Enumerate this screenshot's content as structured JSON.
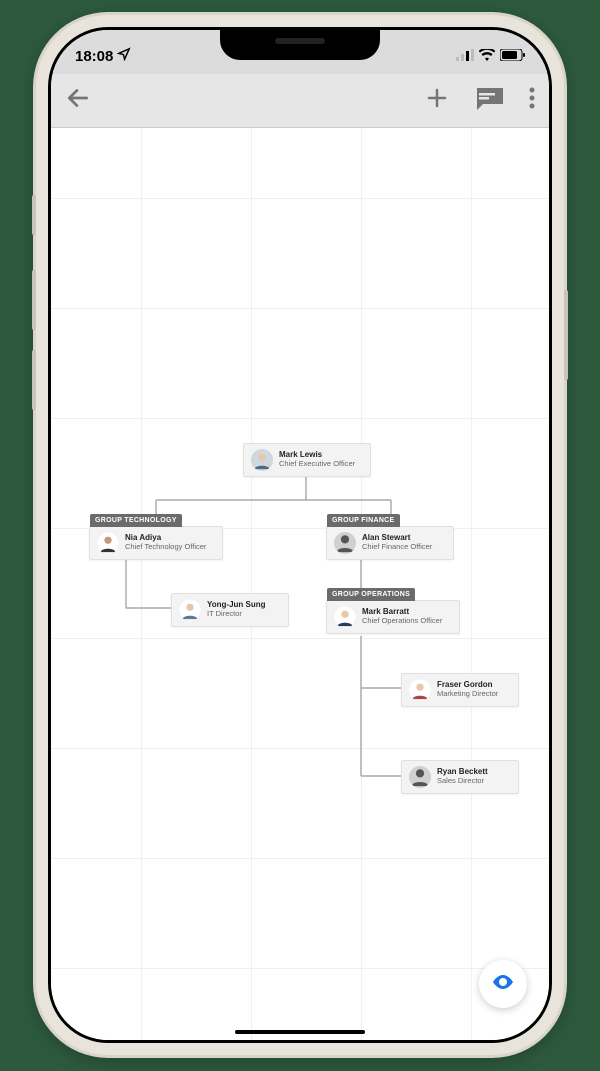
{
  "status": {
    "time": "18:08"
  },
  "org": {
    "ceo": {
      "name": "Mark Lewis",
      "title": "Chief Executive Officer"
    },
    "groups": {
      "tech": {
        "label": "GROUP TECHNOLOGY",
        "lead": {
          "name": "Nia Adiya",
          "title": "Chief Technology Officer"
        },
        "reports": [
          {
            "name": "Yong-Jun Sung",
            "title": "IT Director"
          }
        ]
      },
      "finance": {
        "label": "GROUP FINANCE",
        "lead": {
          "name": "Alan Stewart",
          "title": "Chief Finance Officer"
        }
      },
      "ops": {
        "label": "GROUP OPERATIONS",
        "lead": {
          "name": "Mark Barratt",
          "title": "Chief Operations Officer"
        },
        "reports": [
          {
            "name": "Fraser Gordon",
            "title": "Marketing Director"
          },
          {
            "name": "Ryan Beckett",
            "title": "Sales Director"
          }
        ]
      }
    }
  }
}
